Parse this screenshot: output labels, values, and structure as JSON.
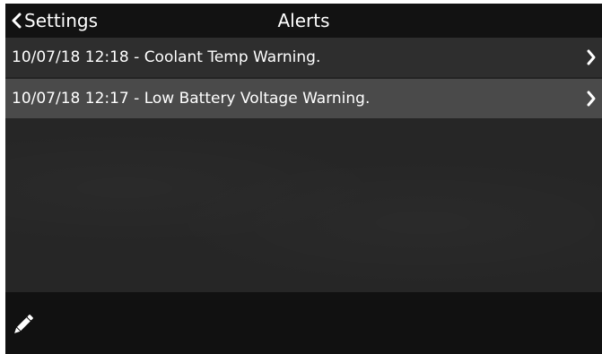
{
  "header": {
    "back_label": "Settings",
    "title": "Alerts"
  },
  "alerts": [
    {
      "text": "10/07/18 12:18 - Coolant Temp Warning."
    },
    {
      "text": "10/07/18 12:17 - Low Battery Voltage Warning."
    }
  ],
  "icons": {
    "back": "chevron-left-icon",
    "row_action": "chevron-right-icon",
    "edit": "pencil-icon"
  },
  "colors": {
    "header_bg": "#121212",
    "row_bg": "#2e2e2e",
    "row_selected_bg": "#4a4a4a",
    "content_bg": "#262626",
    "footer_bg": "#111111",
    "text": "#ffffff"
  }
}
